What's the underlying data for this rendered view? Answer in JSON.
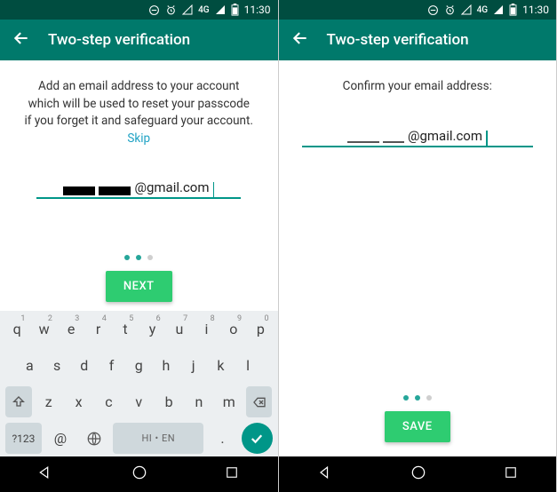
{
  "status": {
    "net": "4G",
    "time": "11:30"
  },
  "appbar": {
    "title": "Two-step verification"
  },
  "left": {
    "msg_a": "Add an email address to your account which will be used to reset your passcode if you forget it and safeguard your account. ",
    "skip": "Skip",
    "email_suffix": "@gmail.com",
    "next": "NEXT",
    "kb": {
      "r1": [
        "q",
        "w",
        "e",
        "r",
        "t",
        "y",
        "u",
        "i",
        "o",
        "p"
      ],
      "r1n": [
        "1",
        "2",
        "3",
        "4",
        "5",
        "6",
        "7",
        "8",
        "9",
        "0"
      ],
      "r2": [
        "a",
        "s",
        "d",
        "f",
        "g",
        "h",
        "j",
        "k",
        "l"
      ],
      "r3": [
        "z",
        "x",
        "c",
        "v",
        "b",
        "n",
        "m"
      ],
      "sym": "?123",
      "at": "@",
      "space": "HI • EN",
      "dot": "."
    }
  },
  "right": {
    "msg": "Confirm your email address:",
    "email_suffix": "@gmail.com",
    "save": "SAVE"
  }
}
